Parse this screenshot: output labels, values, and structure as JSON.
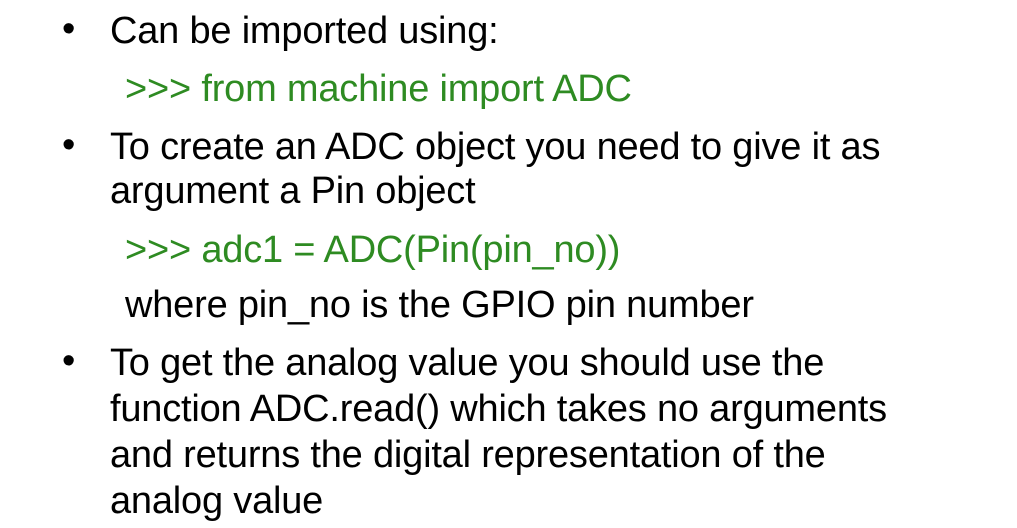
{
  "bullets": [
    {
      "lines": [
        "Can be imported using:"
      ],
      "sub": [
        {
          "text": ">>> from machine import ADC",
          "code": true
        }
      ]
    },
    {
      "lines": [
        "To create an ADC object you need to give it as",
        "argument a Pin object"
      ],
      "sub": [
        {
          "text": ">>> adc1 = ADC(Pin(pin_no))",
          "code": true
        },
        {
          "text": "where pin_no is the GPIO pin number",
          "code": false
        }
      ]
    },
    {
      "lines": [
        "To get the analog value you should use the",
        "function ADC.read() which takes no arguments",
        "and returns the digital representation of the",
        "analog value"
      ],
      "sub": []
    }
  ],
  "bullet_symbol": "•",
  "colors": {
    "text": "#000000",
    "code": "#2e8b22",
    "background": "#ffffff"
  }
}
